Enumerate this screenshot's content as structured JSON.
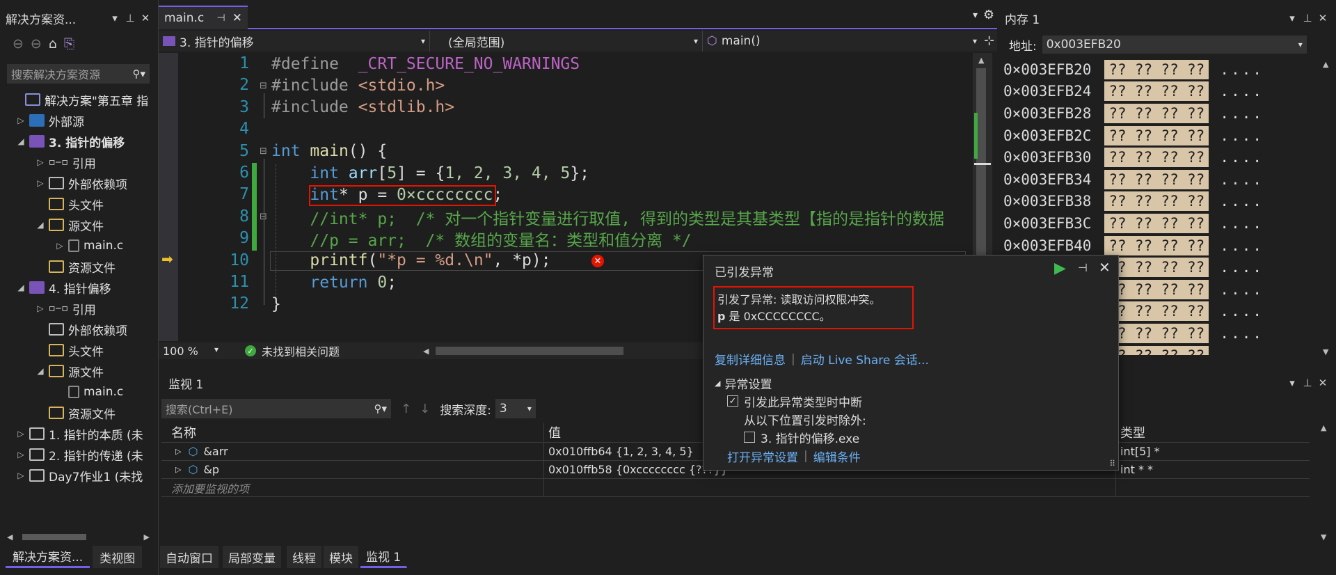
{
  "solution_explorer": {
    "title": "解决方案资...",
    "search_placeholder": "搜索解决方案资源",
    "items": [
      {
        "label": "解决方案\"第五章 指",
        "bold": false
      },
      {
        "label": "外部源",
        "bold": false
      },
      {
        "label": "3. 指针的偏移",
        "bold": true
      },
      {
        "label": "引用",
        "bold": false
      },
      {
        "label": "外部依赖项",
        "bold": false
      },
      {
        "label": "头文件",
        "bold": false
      },
      {
        "label": "源文件",
        "bold": false
      },
      {
        "label": "main.c",
        "bold": false
      },
      {
        "label": "资源文件",
        "bold": false
      },
      {
        "label": "4. 指针偏移",
        "bold": false
      },
      {
        "label": "引用",
        "bold": false
      },
      {
        "label": "外部依赖项",
        "bold": false
      },
      {
        "label": "头文件",
        "bold": false
      },
      {
        "label": "源文件",
        "bold": false
      },
      {
        "label": "main.c",
        "bold": false
      },
      {
        "label": "资源文件",
        "bold": false
      },
      {
        "label": "1. 指针的本质 (未",
        "bold": false
      },
      {
        "label": "2. 指针的传递 (未",
        "bold": false
      },
      {
        "label": "Day7作业1 (未找",
        "bold": false
      }
    ],
    "bottom_tabs": [
      "解决方案资...",
      "类视图"
    ]
  },
  "editor": {
    "tab_label": "main.c",
    "nav_project": "3. 指针的偏移",
    "nav_scope": "(全局范围)",
    "nav_function": "main()",
    "zoom": "100 %",
    "status": "未找到相关问题",
    "line_numbers": [
      "1",
      "2",
      "3",
      "4",
      "5",
      "6",
      "7",
      "8",
      "9",
      "10",
      "11",
      "12"
    ],
    "lines": {
      "l1_pp": "#define",
      "l1_macro": "_CRT_SECURE_NO_WARNINGS",
      "l2_pp": "#include",
      "l2_hdr": "<stdio.h>",
      "l3_pp": "#include",
      "l3_hdr": "<stdlib.h>",
      "l5_kw": "int",
      "l5_fn": "main",
      "l5_rest": "() {",
      "l6_kw": "int",
      "l6_var": "arr",
      "l6_rest1": "[",
      "l6_n5": "5",
      "l6_rest2": "] = {",
      "l6_vals": "1, 2, 3, 4, 5",
      "l6_rest3": "};",
      "l7_kw": "int",
      "l7_rest": "* p = ",
      "l7_num": "0×cccccccc",
      "l7_end": ";",
      "l8_cmt": "//int* p;  /* 对一个指针变量进行取值, 得到的类型是其基类型【指的是指针的数据",
      "l9_cmt": "//p = arr;  /* 数组的变量名：类型和值分离 */",
      "l10_fn": "printf",
      "l10_p1": "(",
      "l10_str": "\"*p = %d.\\n\"",
      "l10_p2": ", *p);",
      "l11_kw": "return",
      "l11_num": "0",
      "l11_end": ";",
      "l12": "}"
    }
  },
  "memory": {
    "title": "内存 1",
    "address_label": "地址:",
    "address_value": "0x003EFB20",
    "rows": [
      {
        "addr": "0×003EFB20",
        "bytes": [
          "??",
          "??",
          "??",
          "??"
        ],
        "ascii": "...."
      },
      {
        "addr": "0×003EFB24",
        "bytes": [
          "??",
          "??",
          "??",
          "??"
        ],
        "ascii": "...."
      },
      {
        "addr": "0×003EFB28",
        "bytes": [
          "??",
          "??",
          "??",
          "??"
        ],
        "ascii": "...."
      },
      {
        "addr": "0×003EFB2C",
        "bytes": [
          "??",
          "??",
          "??",
          "??"
        ],
        "ascii": "...."
      },
      {
        "addr": "0×003EFB30",
        "bytes": [
          "??",
          "??",
          "??",
          "??"
        ],
        "ascii": "...."
      },
      {
        "addr": "0×003EFB34",
        "bytes": [
          "??",
          "??",
          "??",
          "??"
        ],
        "ascii": "...."
      },
      {
        "addr": "0×003EFB38",
        "bytes": [
          "??",
          "??",
          "??",
          "??"
        ],
        "ascii": "...."
      },
      {
        "addr": "0×003EFB3C",
        "bytes": [
          "??",
          "??",
          "??",
          "??"
        ],
        "ascii": "...."
      },
      {
        "addr": "0×003EFB40",
        "bytes": [
          "??",
          "??",
          "??",
          "??"
        ],
        "ascii": "...."
      },
      {
        "addr": "",
        "bytes": [
          "??",
          "??",
          "??",
          "??"
        ],
        "ascii": "...."
      },
      {
        "addr": "",
        "bytes": [
          "??",
          "??",
          "??",
          "??"
        ],
        "ascii": "...."
      },
      {
        "addr": "",
        "bytes": [
          "??",
          "??",
          "??",
          "??"
        ],
        "ascii": "...."
      },
      {
        "addr": "",
        "bytes": [
          "??",
          "??",
          "??",
          "??"
        ],
        "ascii": "...."
      },
      {
        "addr": "",
        "bytes": [
          "??",
          "??",
          "??",
          "??"
        ],
        "ascii": "...."
      }
    ]
  },
  "exception": {
    "title": "已引发异常",
    "message_line1": "引发了异常: 读取访问权限冲突。",
    "message_bold": "p",
    "message_line2_rest": " 是 0xCCCCCCCC。",
    "copy_details": "复制详细信息",
    "live_share": "启动 Live Share 会话...",
    "settings_header": "异常设置",
    "break_label": "引发此异常类型时中断",
    "except_when": "从以下位置引发时除外:",
    "exe_label": "3. 指针的偏移.exe",
    "open_settings": "打开异常设置",
    "edit_conditions": "编辑条件"
  },
  "watch": {
    "title": "监视 1",
    "search_placeholder": "搜索(Ctrl+E)",
    "depth_label": "搜索深度:",
    "depth_value": "3",
    "col_name": "名称",
    "col_value": "值",
    "col_type": "类型",
    "rows": [
      {
        "name": "&arr",
        "value": "0x010ffb64 {1, 2, 3, 4, 5}",
        "type": "int[5] *"
      },
      {
        "name": "&p",
        "value": "0x010ffb58 {0xcccccccc {???}}",
        "type": "int * *"
      }
    ],
    "add_placeholder": "添加要监视的项"
  },
  "bottom_tabs": [
    "自动窗口",
    "局部变量",
    "线程",
    "模块",
    "监视 1"
  ],
  "colors": {
    "accent": "#7160e8",
    "highlight_box": "#e51400",
    "memory_bg": "#d9c6a8"
  }
}
